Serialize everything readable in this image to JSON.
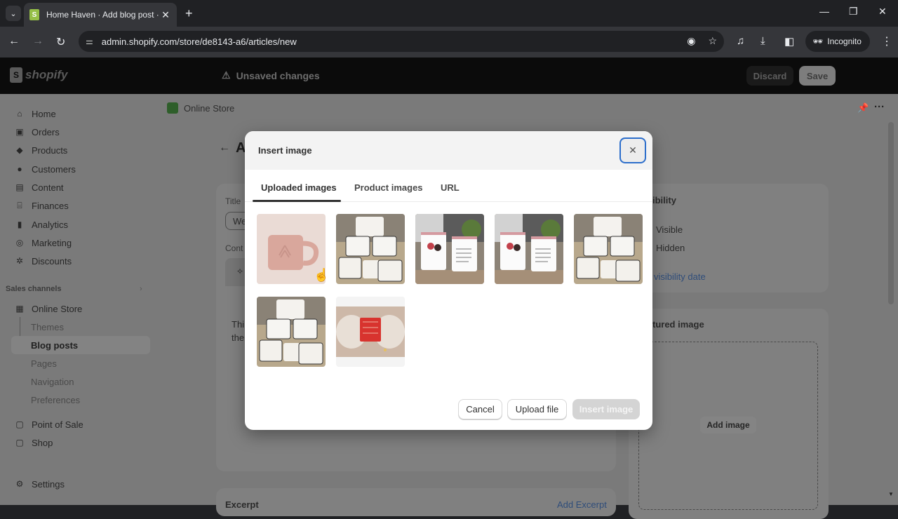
{
  "browser": {
    "tab_title": "Home Haven · Add blog post · Shopify",
    "url": "admin.shopify.com/store/de8143-a6/articles/new",
    "incognito_label": "Incognito"
  },
  "topbar": {
    "logo": "shopify",
    "unsaved": "Unsaved changes",
    "discard": "Discard",
    "save": "Save"
  },
  "sidebar": {
    "items": [
      {
        "label": "Home",
        "icon": "home-icon",
        "glyph": "⌂"
      },
      {
        "label": "Orders",
        "icon": "inbox-icon",
        "glyph": "▣"
      },
      {
        "label": "Products",
        "icon": "tag-icon",
        "glyph": "◆"
      },
      {
        "label": "Customers",
        "icon": "person-icon",
        "glyph": "●"
      },
      {
        "label": "Content",
        "icon": "image-icon",
        "glyph": "▤"
      },
      {
        "label": "Finances",
        "icon": "bank-icon",
        "glyph": "⌸"
      },
      {
        "label": "Analytics",
        "icon": "bar-chart-icon",
        "glyph": "▮"
      },
      {
        "label": "Marketing",
        "icon": "target-icon",
        "glyph": "◎"
      },
      {
        "label": "Discounts",
        "icon": "discount-icon",
        "glyph": "✲"
      }
    ],
    "sales_channels_label": "Sales channels",
    "online_store": "Online Store",
    "online_store_sub": [
      "Themes",
      "Blog posts",
      "Pages",
      "Navigation",
      "Preferences"
    ],
    "point_of_sale": "Point of Sale",
    "shop": "Shop",
    "settings": "Settings"
  },
  "page": {
    "breadcrumb": "Online Store",
    "title_letter": "A",
    "title_label": "Title",
    "title_value": "We",
    "content_label": "Cont",
    "content_text_1": "Thi",
    "content_text_2": "the",
    "excerpt_label": "Excerpt",
    "add_excerpt": "Add Excerpt",
    "visibility_title": "ibility",
    "visible": "Visible",
    "hidden": "Hidden",
    "visibility_date": "visibility date",
    "featured_title": "tured image",
    "add_image": "Add image"
  },
  "modal": {
    "title": "Insert image",
    "tabs": [
      "Uploaded images",
      "Product images",
      "URL"
    ],
    "active_tab": "Uploaded images",
    "images": [
      {
        "alt": "pink ceramic mug"
      },
      {
        "alt": "stack of white enamel mugs"
      },
      {
        "alt": "two printed mugs with pink interior"
      },
      {
        "alt": "two printed mugs with pink interior"
      },
      {
        "alt": "stack of white enamel mugs"
      },
      {
        "alt": "stack of white enamel mugs"
      },
      {
        "alt": "hands holding red gift box"
      }
    ],
    "cancel": "Cancel",
    "upload": "Upload file",
    "insert": "Insert image"
  }
}
